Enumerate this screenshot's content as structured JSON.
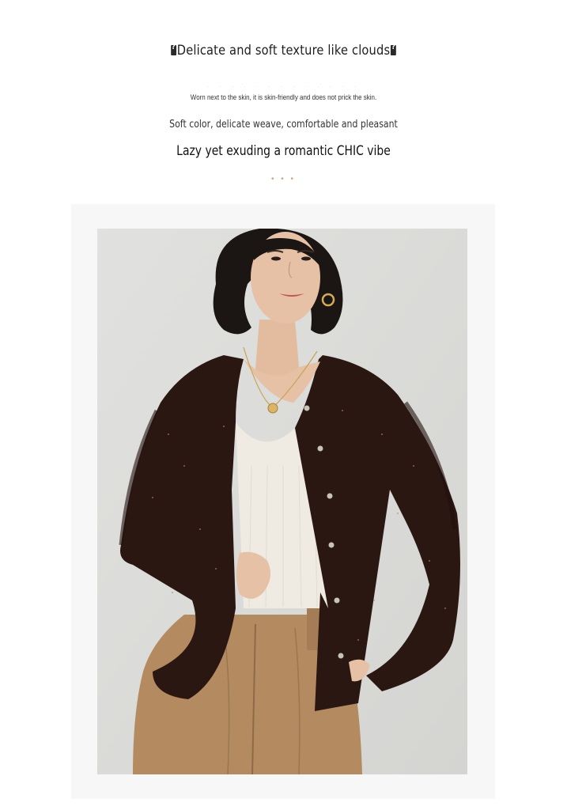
{
  "header": {
    "title": "Delicate and soft texture like clouds",
    "subtitle_small": "Worn next to the skin, it is skin-friendly and does not prick the skin.",
    "subtitle_medium": "Soft color, delicate weave, comfortable and pleasant",
    "tagline": "Lazy yet exuding a romantic CHIC vibe",
    "dots": "• • •"
  },
  "photo": {
    "subject": "woman wearing dark brown sequin knit cardigan, white ribbed top and camel trousers",
    "colors": {
      "wall": "#dcdcda",
      "cardigan": "#2b1712",
      "top": "#efeae2",
      "trousers": "#b48a60",
      "skin": "#e6c1a6",
      "hair": "#1b1614"
    }
  }
}
